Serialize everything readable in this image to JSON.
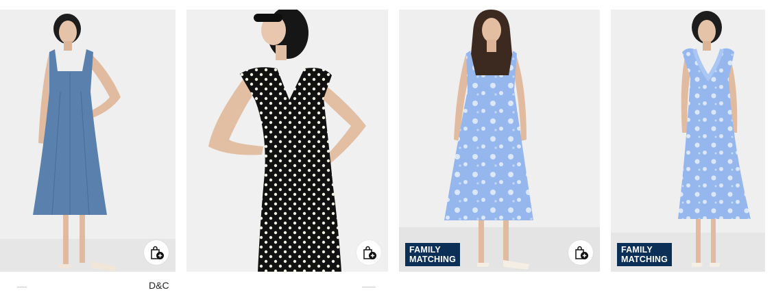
{
  "products": [
    {
      "id": "denim",
      "badge": null,
      "bag_icon": "shopping-bag-plus-icon",
      "dress_color": "#5a80ad"
    },
    {
      "id": "polka",
      "badge": null,
      "bag_icon": "shopping-bag-plus-icon",
      "dress_color": "#111111"
    },
    {
      "id": "floral-1",
      "badge": [
        "FAMILY",
        "MATCHING"
      ],
      "bag_icon": "shopping-bag-plus-icon",
      "dress_color": "#95b7ee"
    },
    {
      "id": "floral-2",
      "badge": [
        "FAMILY",
        "MATCHING"
      ],
      "bag_icon": null,
      "dress_color": "#95b7ee"
    }
  ],
  "below_cards": {
    "brand_label": "D&C"
  },
  "colors": {
    "badge_bg": "#0b2f57",
    "card_bg": "#eeeeee"
  }
}
